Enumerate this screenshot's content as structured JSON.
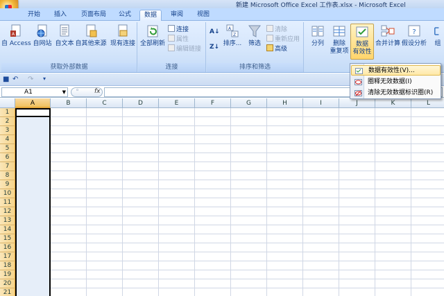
{
  "window": {
    "title": "新建 Microsoft Office Excel 工作表.xlsx - Microsoft Excel"
  },
  "tabs": [
    {
      "label": "开始",
      "active": false
    },
    {
      "label": "插入",
      "active": false
    },
    {
      "label": "页面布局",
      "active": false
    },
    {
      "label": "公式",
      "active": false
    },
    {
      "label": "数据",
      "active": true
    },
    {
      "label": "审阅",
      "active": false
    },
    {
      "label": "视图",
      "active": false
    }
  ],
  "ribbon": {
    "external": {
      "group_label": "获取外部数据",
      "access": "自 Access",
      "web": "自网站",
      "text": "自文本",
      "other_line1": "自其他来源",
      "existing": "现有连接"
    },
    "connections": {
      "group_label": "连接",
      "refresh_all": "全部刷新",
      "links": "连接",
      "properties": "属性",
      "edit_links": "编辑链接"
    },
    "sort_filter": {
      "group_label": "排序和筛选",
      "sort": "排序...",
      "filter": "筛选",
      "clear": "清除",
      "reapply": "重新应用",
      "advanced": "高级"
    },
    "tools": {
      "split": "分列",
      "remove_dup_1": "删除",
      "remove_dup_2": "重复项",
      "validation_1": "数据",
      "validation_2": "有效性",
      "consolidate": "合并计算",
      "whatif": "假设分析",
      "group_partial": "组"
    }
  },
  "menu": {
    "items": [
      {
        "label": "数据有效性(V)...",
        "highlighted": true
      },
      {
        "label": "圈释无效数据(I)",
        "highlighted": false
      },
      {
        "label": "清除无效数据标识圈(R)",
        "highlighted": false
      }
    ]
  },
  "formula_bar": {
    "name_box": "A1",
    "fx": "fx",
    "content": ""
  },
  "sheet": {
    "columns": [
      "A",
      "B",
      "C",
      "D",
      "E",
      "F",
      "G",
      "H",
      "I",
      "J",
      "K",
      "L"
    ],
    "rows": [
      "1",
      "2",
      "3",
      "4",
      "5",
      "6",
      "7",
      "8",
      "9",
      "10",
      "11",
      "12",
      "13",
      "14",
      "15",
      "16",
      "17",
      "18",
      "19",
      "20",
      "21"
    ],
    "selected_column": "A",
    "active_cell": "A1"
  },
  "colors": {
    "ribbon": "#d4e5fb",
    "tab_bar": "#bfdbff",
    "row_header": "#f6d48a",
    "highlight": "#ffd56b",
    "text": "#15428b"
  }
}
